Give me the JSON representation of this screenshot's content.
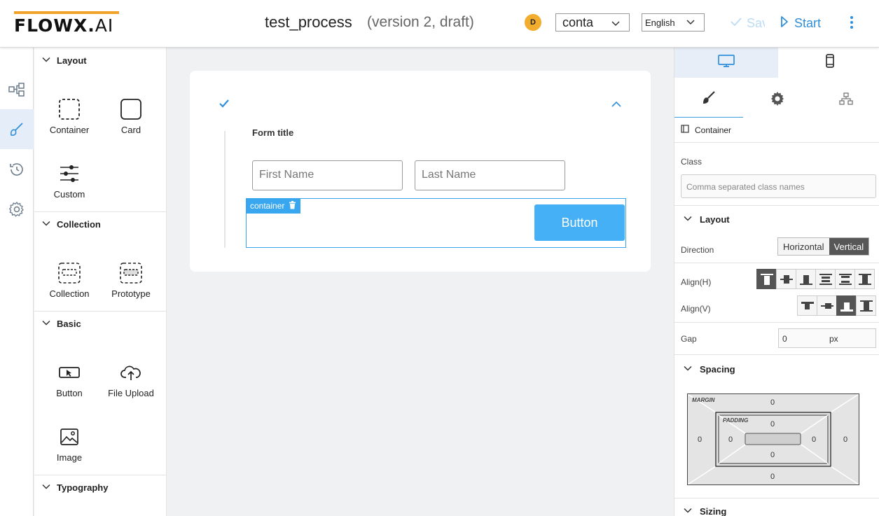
{
  "header": {
    "logo_main": "FLOWX.",
    "logo_ai": "AI",
    "title": "test_process",
    "subtitle": "(version 2, draft)",
    "avatar_initial": "D",
    "env_value": "conta",
    "lang_value": "English",
    "save_label": "Save",
    "start_label": "Start"
  },
  "rail": {
    "items": [
      "process-graph-icon",
      "brush-icon",
      "history-icon",
      "settings-icon"
    ],
    "active_index": 1
  },
  "components": {
    "sections": [
      {
        "title": "Layout",
        "items": [
          "Container",
          "Card",
          "Custom"
        ]
      },
      {
        "title": "Collection",
        "items": [
          "Collection",
          "Prototype"
        ]
      },
      {
        "title": "Basic",
        "items": [
          "Button",
          "File Upload",
          "Image"
        ]
      },
      {
        "title": "Typography",
        "items": []
      }
    ]
  },
  "canvas": {
    "form_title": "Form title",
    "first_name_placeholder": "First Name",
    "last_name_placeholder": "Last Name",
    "container_tag": "container",
    "button_label": "Button"
  },
  "props": {
    "breadcrumb": "Container",
    "class_label": "Class",
    "class_placeholder": "Comma separated class names",
    "layout_title": "Layout",
    "direction_label": "Direction",
    "direction_options": [
      "Horizontal",
      "Vertical"
    ],
    "direction_selected": "Vertical",
    "align_h_label": "Align(H)",
    "align_h_selected_index": 0,
    "align_v_label": "Align(V)",
    "align_v_selected_index": 2,
    "gap_label": "Gap",
    "gap_value": "0",
    "gap_unit": "px",
    "spacing_title": "Spacing",
    "margin_label": "MARGIN",
    "padding_label": "PADDING",
    "margin": {
      "top": "0",
      "right": "0",
      "bottom": "0",
      "left": "0"
    },
    "padding": {
      "top": "0",
      "right": "0",
      "bottom": "0",
      "left": "0"
    },
    "sizing_title": "Sizing"
  },
  "colors": {
    "accent": "#2f8fdb",
    "logo_bar": "#f0a22a",
    "avatar": "#f2ad2f",
    "button": "#45b0f5"
  }
}
